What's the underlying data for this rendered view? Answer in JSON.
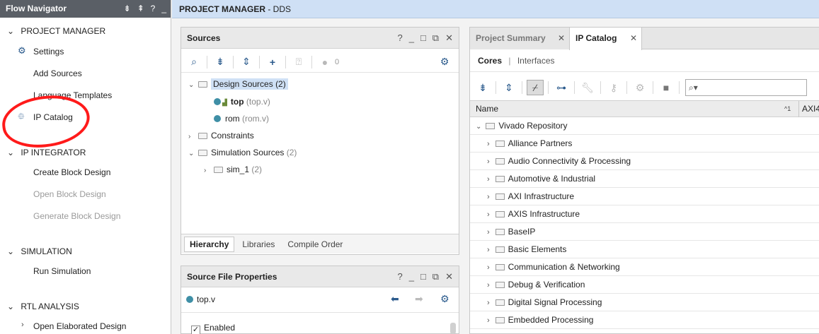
{
  "flow_navigator": {
    "title": "Flow Navigator",
    "title_icons": [
      "collapse-all-icon",
      "expand-all-icon",
      "help-icon",
      "minimize-icon"
    ],
    "sections": [
      {
        "label": "PROJECT MANAGER",
        "expanded": true,
        "items": [
          {
            "label": "Settings",
            "icon": "gear-icon",
            "enabled": true
          },
          {
            "label": "Add Sources",
            "enabled": true
          },
          {
            "label": "Language Templates",
            "enabled": true
          },
          {
            "label": "IP Catalog",
            "icon": "ip-chip-icon",
            "enabled": true
          }
        ]
      },
      {
        "label": "IP INTEGRATOR",
        "expanded": true,
        "items": [
          {
            "label": "Create Block Design",
            "enabled": true
          },
          {
            "label": "Open Block Design",
            "enabled": false
          },
          {
            "label": "Generate Block Design",
            "enabled": false
          }
        ]
      },
      {
        "label": "SIMULATION",
        "expanded": true,
        "items": [
          {
            "label": "Run Simulation",
            "enabled": true
          }
        ]
      },
      {
        "label": "RTL ANALYSIS",
        "expanded": true,
        "items": [
          {
            "label": "Open Elaborated Design",
            "enabled": true
          }
        ]
      }
    ]
  },
  "header": {
    "title_bold": "PROJECT MANAGER",
    "title_rest": " - DDS"
  },
  "sources": {
    "title": "Sources",
    "title_controls": [
      "?",
      "_",
      "□",
      "⧉",
      "✕"
    ],
    "counter": "0",
    "tree": [
      {
        "label": "Design Sources",
        "count": "(2)",
        "level": 0,
        "expanded": true,
        "selected": true
      },
      {
        "label": "top",
        "suffix": "(top.v)",
        "level": 1,
        "bold": true
      },
      {
        "label": "rom",
        "suffix": "(rom.v)",
        "level": 1
      },
      {
        "label": "Constraints",
        "count": "",
        "level": 0,
        "expanded": false
      },
      {
        "label": "Simulation Sources",
        "count": "(2)",
        "level": 0,
        "expanded": true
      },
      {
        "label": "sim_1",
        "count": "(2)",
        "level": 1,
        "expanded": false
      }
    ],
    "tabs": [
      "Hierarchy",
      "Libraries",
      "Compile Order"
    ],
    "active_tab": "Hierarchy"
  },
  "source_file_properties": {
    "title": "Source File Properties",
    "file": "top.v",
    "enabled_label": "Enabled",
    "enabled_checked": true
  },
  "right_panel": {
    "tabs": [
      {
        "label": "Project Summary",
        "active": false
      },
      {
        "label": "IP Catalog",
        "active": true
      }
    ],
    "subtabs": {
      "cores": "Cores",
      "separator": "|",
      "interfaces": "Interfaces"
    },
    "columns": [
      "Name",
      "AXI4"
    ],
    "sort_indicator": "^1",
    "repository": "Vivado Repository",
    "categories": [
      "Alliance Partners",
      "Audio Connectivity & Processing",
      "Automotive & Industrial",
      "AXI Infrastructure",
      "AXIS Infrastructure",
      "BaseIP",
      "Basic Elements",
      "Communication & Networking",
      "Debug & Verification",
      "Digital Signal Processing",
      "Embedded Processing"
    ]
  },
  "colors": {
    "header_blue": "#cfe0f5",
    "nav_title": "#5a5f66",
    "annotation_red": "#ff1a1a",
    "accent": "#2a5a8c"
  }
}
